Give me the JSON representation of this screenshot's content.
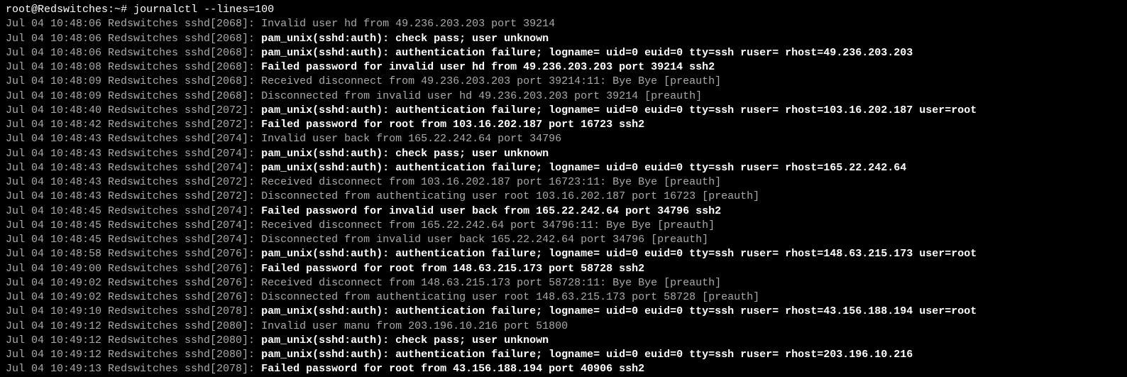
{
  "prompt": {
    "user_host": "root@Redswitches",
    "path": "~",
    "symbol": "#",
    "command": "journalctl --lines=100"
  },
  "logs": [
    {
      "prefix": "Jul 04 10:48:06 Redswitches sshd[2068]: ",
      "msg": "Invalid user hd from 49.236.203.203 port 39214",
      "bold": false
    },
    {
      "prefix": "Jul 04 10:48:06 Redswitches sshd[2068]: ",
      "msg": "pam_unix(sshd:auth): check pass; user unknown",
      "bold": true
    },
    {
      "prefix": "Jul 04 10:48:06 Redswitches sshd[2068]: ",
      "msg": "pam_unix(sshd:auth): authentication failure; logname= uid=0 euid=0 tty=ssh ruser= rhost=49.236.203.203",
      "bold": true
    },
    {
      "prefix": "Jul 04 10:48:08 Redswitches sshd[2068]: ",
      "msg": "Failed password for invalid user hd from 49.236.203.203 port 39214 ssh2",
      "bold": true
    },
    {
      "prefix": "Jul 04 10:48:09 Redswitches sshd[2068]: ",
      "msg": "Received disconnect from 49.236.203.203 port 39214:11: Bye Bye [preauth]",
      "bold": false
    },
    {
      "prefix": "Jul 04 10:48:09 Redswitches sshd[2068]: ",
      "msg": "Disconnected from invalid user hd 49.236.203.203 port 39214 [preauth]",
      "bold": false
    },
    {
      "prefix": "Jul 04 10:48:40 Redswitches sshd[2072]: ",
      "msg": "pam_unix(sshd:auth): authentication failure; logname= uid=0 euid=0 tty=ssh ruser= rhost=103.16.202.187  user=root",
      "bold": true
    },
    {
      "prefix": "Jul 04 10:48:42 Redswitches sshd[2072]: ",
      "msg": "Failed password for root from 103.16.202.187 port 16723 ssh2",
      "bold": true
    },
    {
      "prefix": "Jul 04 10:48:43 Redswitches sshd[2074]: ",
      "msg": "Invalid user back from 165.22.242.64 port 34796",
      "bold": false
    },
    {
      "prefix": "Jul 04 10:48:43 Redswitches sshd[2074]: ",
      "msg": "pam_unix(sshd:auth): check pass; user unknown",
      "bold": true
    },
    {
      "prefix": "Jul 04 10:48:43 Redswitches sshd[2074]: ",
      "msg": "pam_unix(sshd:auth): authentication failure; logname= uid=0 euid=0 tty=ssh ruser= rhost=165.22.242.64",
      "bold": true
    },
    {
      "prefix": "Jul 04 10:48:43 Redswitches sshd[2072]: ",
      "msg": "Received disconnect from 103.16.202.187 port 16723:11: Bye Bye [preauth]",
      "bold": false
    },
    {
      "prefix": "Jul 04 10:48:43 Redswitches sshd[2072]: ",
      "msg": "Disconnected from authenticating user root 103.16.202.187 port 16723 [preauth]",
      "bold": false
    },
    {
      "prefix": "Jul 04 10:48:45 Redswitches sshd[2074]: ",
      "msg": "Failed password for invalid user back from 165.22.242.64 port 34796 ssh2",
      "bold": true
    },
    {
      "prefix": "Jul 04 10:48:45 Redswitches sshd[2074]: ",
      "msg": "Received disconnect from 165.22.242.64 port 34796:11: Bye Bye [preauth]",
      "bold": false
    },
    {
      "prefix": "Jul 04 10:48:45 Redswitches sshd[2074]: ",
      "msg": "Disconnected from invalid user back 165.22.242.64 port 34796 [preauth]",
      "bold": false
    },
    {
      "prefix": "Jul 04 10:48:58 Redswitches sshd[2076]: ",
      "msg": "pam_unix(sshd:auth): authentication failure; logname= uid=0 euid=0 tty=ssh ruser= rhost=148.63.215.173  user=root",
      "bold": true
    },
    {
      "prefix": "Jul 04 10:49:00 Redswitches sshd[2076]: ",
      "msg": "Failed password for root from 148.63.215.173 port 58728 ssh2",
      "bold": true
    },
    {
      "prefix": "Jul 04 10:49:02 Redswitches sshd[2076]: ",
      "msg": "Received disconnect from 148.63.215.173 port 58728:11: Bye Bye [preauth]",
      "bold": false
    },
    {
      "prefix": "Jul 04 10:49:02 Redswitches sshd[2076]: ",
      "msg": "Disconnected from authenticating user root 148.63.215.173 port 58728 [preauth]",
      "bold": false
    },
    {
      "prefix": "Jul 04 10:49:10 Redswitches sshd[2078]: ",
      "msg": "pam_unix(sshd:auth): authentication failure; logname= uid=0 euid=0 tty=ssh ruser= rhost=43.156.188.194  user=root",
      "bold": true
    },
    {
      "prefix": "Jul 04 10:49:12 Redswitches sshd[2080]: ",
      "msg": "Invalid user manu from 203.196.10.216 port 51800",
      "bold": false
    },
    {
      "prefix": "Jul 04 10:49:12 Redswitches sshd[2080]: ",
      "msg": "pam_unix(sshd:auth): check pass; user unknown",
      "bold": true
    },
    {
      "prefix": "Jul 04 10:49:12 Redswitches sshd[2080]: ",
      "msg": "pam_unix(sshd:auth): authentication failure; logname= uid=0 euid=0 tty=ssh ruser= rhost=203.196.10.216",
      "bold": true
    },
    {
      "prefix": "Jul 04 10:49:13 Redswitches sshd[2078]: ",
      "msg": "Failed password for root from 43.156.188.194 port 40906 ssh2",
      "bold": true
    }
  ]
}
